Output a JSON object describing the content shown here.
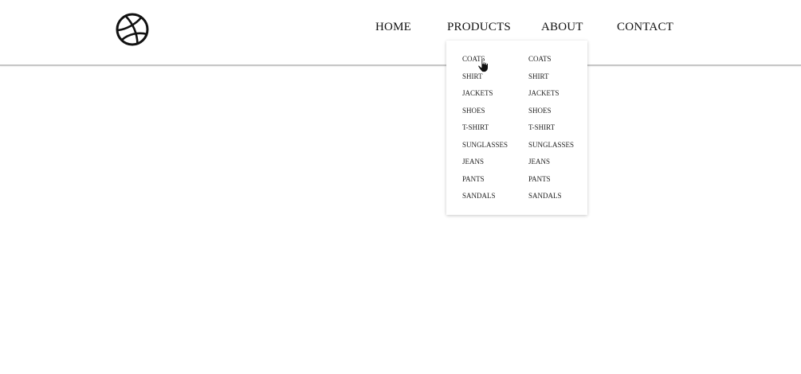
{
  "nav": {
    "home": "HOME",
    "products": "PRODUCTS",
    "about": "ABOUT",
    "contact": "CONTACT"
  },
  "dropdown": {
    "column1": [
      "COATS",
      "SHIRT",
      "JACKETS",
      "SHOES",
      "T-SHIRT",
      "SUNGLASSES",
      "JEANS",
      "PANTS",
      "SANDALS"
    ],
    "column2": [
      "COATS",
      "SHIRT",
      "JACKETS",
      "SHOES",
      "T-SHIRT",
      "SUNGLASSES",
      "JEANS",
      "PANTS",
      "SANDALS"
    ]
  },
  "icons": {
    "logo": "dribbble-ball-icon",
    "cursor": "hand-pointer-icon"
  },
  "colors": {
    "text": "#111111",
    "border": "#c6c6c6",
    "background": "#ffffff"
  }
}
